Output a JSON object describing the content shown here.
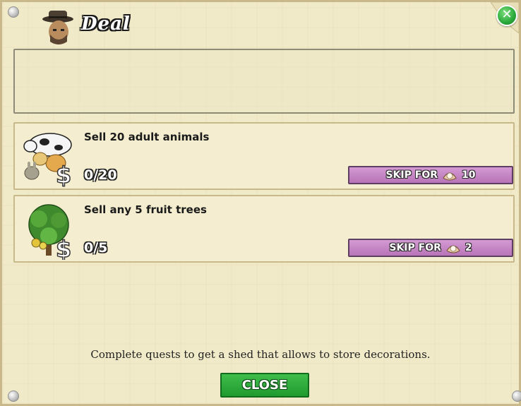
{
  "dialog": {
    "title": "Deal",
    "close_icon": "close-x-icon",
    "avatar_icon": "detective-avatar-icon"
  },
  "quests": [
    {
      "text": "Sell 20 adult animals",
      "progress": "0/20",
      "skip_label": "SKIP FOR",
      "skip_cost": "10",
      "icon": "animals-sell-icon"
    },
    {
      "text": "Sell any 5 fruit trees",
      "progress": "0/5",
      "skip_label": "SKIP FOR",
      "skip_cost": "2",
      "icon": "fruit-trees-sell-icon"
    }
  ],
  "footer": {
    "message": "Complete quests to get a shed that allows to store decorations.",
    "close_label": "CLOSE"
  },
  "colors": {
    "panel_bg": "#f1eac8",
    "skip_button": "#c88ac8",
    "close_button": "#2aa83a"
  }
}
